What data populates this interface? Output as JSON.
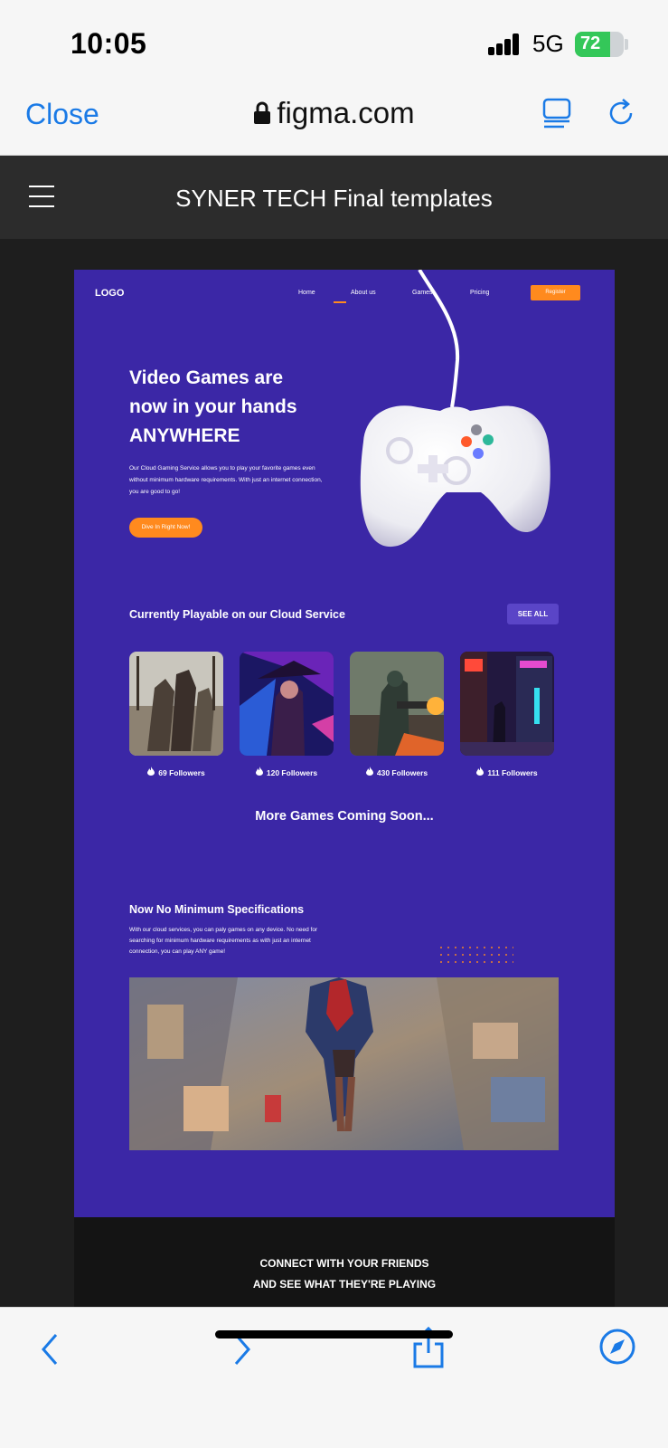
{
  "status": {
    "time": "10:05",
    "network": "5G",
    "battery": "72",
    "battery_level": 0.72
  },
  "safari": {
    "close_label": "Close",
    "url": "figma.com"
  },
  "prototype": {
    "title": "SYNER TECH Final templates"
  },
  "site": {
    "logo": "LOGO",
    "nav": [
      "Home",
      "About us",
      "Games",
      "Pricing"
    ],
    "register_label": "Register",
    "hero": {
      "title_line1": "Video Games are",
      "title_line2": "now in your hands",
      "title_line3": "ANYWHERE",
      "description": "Our Cloud Gaming Service allows you to play your favorite games even without minimum hardware requirements. With just an internet connection, you are good to go!",
      "cta_label": "Dive In Right Now!"
    },
    "playable": {
      "title": "Currently Playable on our Cloud Service",
      "see_all_label": "SEE ALL",
      "cards": [
        {
          "followers": "69 Followers"
        },
        {
          "followers": "120 Followers"
        },
        {
          "followers": "430 Followers"
        },
        {
          "followers": "111 Followers"
        }
      ]
    },
    "coming_soon": "More Games Coming Soon...",
    "specs": {
      "title": "Now No Minimum Specifications",
      "description": "With our cloud services, you can paly games on any device. No need for searching for minimum hardware requirements as with just an internet connection, you can play ANY game!"
    },
    "connect_line1": "CONNECT WITH YOUR FRIENDS",
    "connect_line2": "AND SEE WHAT THEY'RE PLAYING"
  },
  "colors": {
    "site_bg": "#3b27a6",
    "accent": "#ff8a1e",
    "ios_blue": "#1a7ae6"
  },
  "icons": [
    "lock-icon",
    "reader-icon",
    "reload-icon",
    "menu-icon",
    "flame-icon",
    "back-icon",
    "forward-icon",
    "share-icon",
    "compass-icon"
  ]
}
